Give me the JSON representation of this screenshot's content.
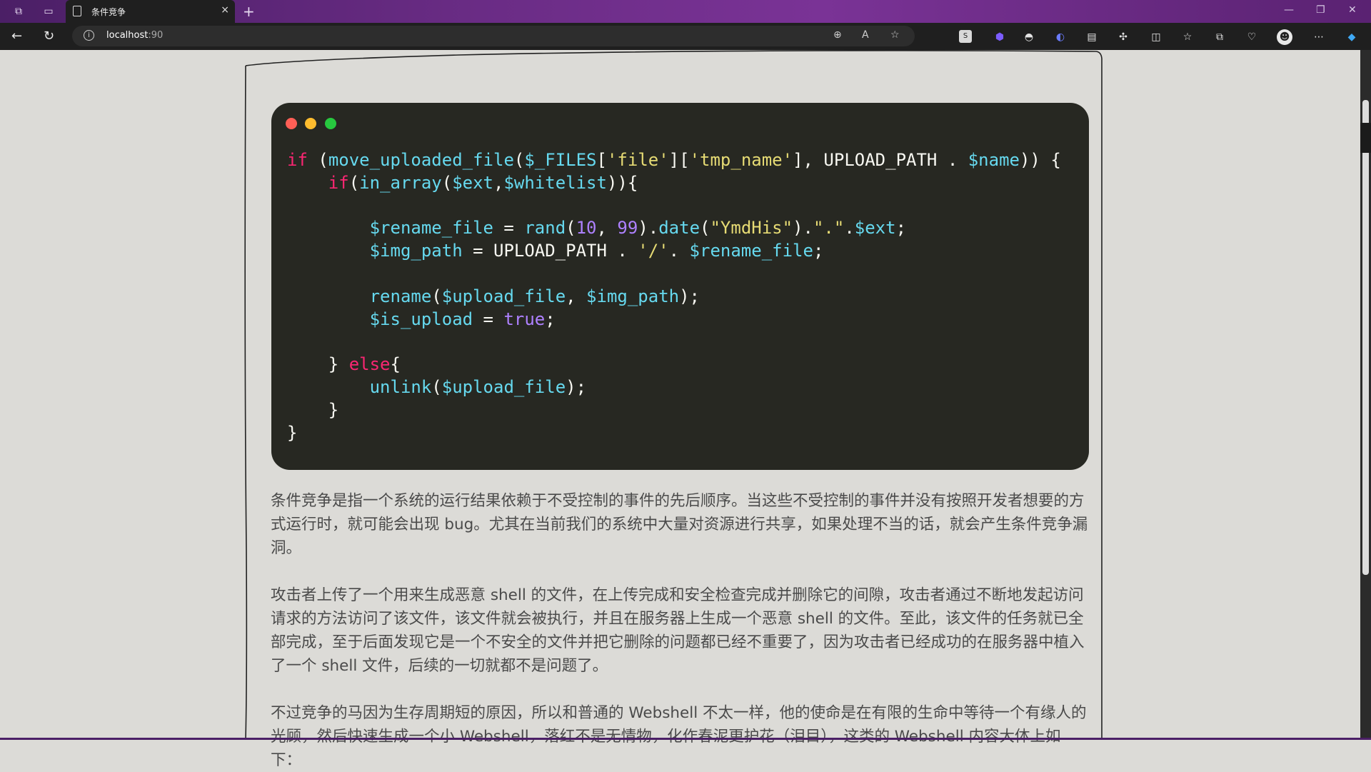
{
  "browser": {
    "tab_title": "条件竞争",
    "new_tab_glyph": "+",
    "close_glyph": "×",
    "url_host": "localhost",
    "url_port": ":90"
  },
  "code_lines": [
    [
      [
        "kw",
        "if"
      ],
      [
        "pl",
        " ("
      ],
      [
        "fn",
        "move_uploaded_file"
      ],
      [
        "pl",
        "("
      ],
      [
        "var",
        "$_FILES"
      ],
      [
        "pl",
        "["
      ],
      [
        "str",
        "'file'"
      ],
      [
        "pl",
        "]["
      ],
      [
        "str",
        "'tmp_name'"
      ],
      [
        "pl",
        "], UPLOAD_PATH . "
      ],
      [
        "var",
        "$name"
      ],
      [
        "pl",
        ")) {"
      ]
    ],
    [
      [
        "pl",
        "    "
      ],
      [
        "kw",
        "if"
      ],
      [
        "pl",
        "("
      ],
      [
        "fn",
        "in_array"
      ],
      [
        "pl",
        "("
      ],
      [
        "var",
        "$ext"
      ],
      [
        "pl",
        ","
      ],
      [
        "var",
        "$whitelist"
      ],
      [
        "pl",
        ")){"
      ]
    ],
    [
      [
        "pl",
        ""
      ]
    ],
    [
      [
        "pl",
        "        "
      ],
      [
        "var",
        "$rename_file"
      ],
      [
        "pl",
        " = "
      ],
      [
        "fn",
        "rand"
      ],
      [
        "pl",
        "("
      ],
      [
        "num",
        "10"
      ],
      [
        "pl",
        ", "
      ],
      [
        "num",
        "99"
      ],
      [
        "pl",
        ")."
      ],
      [
        "fn",
        "date"
      ],
      [
        "pl",
        "("
      ],
      [
        "str",
        "\"YmdHis\""
      ],
      [
        "pl",
        ")."
      ],
      [
        "str",
        "\".\""
      ],
      [
        "pl",
        "."
      ],
      [
        "var",
        "$ext"
      ],
      [
        "pl",
        ";"
      ]
    ],
    [
      [
        "pl",
        "        "
      ],
      [
        "var",
        "$img_path"
      ],
      [
        "pl",
        " = UPLOAD_PATH . "
      ],
      [
        "str",
        "'/'"
      ],
      [
        "pl",
        ". "
      ],
      [
        "var",
        "$rename_file"
      ],
      [
        "pl",
        ";"
      ]
    ],
    [
      [
        "pl",
        ""
      ]
    ],
    [
      [
        "pl",
        "        "
      ],
      [
        "fn",
        "rename"
      ],
      [
        "pl",
        "("
      ],
      [
        "var",
        "$upload_file"
      ],
      [
        "pl",
        ", "
      ],
      [
        "var",
        "$img_path"
      ],
      [
        "pl",
        ");"
      ]
    ],
    [
      [
        "pl",
        "        "
      ],
      [
        "var",
        "$is_upload"
      ],
      [
        "pl",
        " = "
      ],
      [
        "num",
        "true"
      ],
      [
        "pl",
        ";"
      ]
    ],
    [
      [
        "pl",
        ""
      ]
    ],
    [
      [
        "pl",
        "    } "
      ],
      [
        "kw",
        "else"
      ],
      [
        "pl",
        "{"
      ]
    ],
    [
      [
        "pl",
        "        "
      ],
      [
        "fn",
        "unlink"
      ],
      [
        "pl",
        "("
      ],
      [
        "var",
        "$upload_file"
      ],
      [
        "pl",
        ");"
      ]
    ],
    [
      [
        "pl",
        "    }"
      ]
    ],
    [
      [
        "pl",
        "}"
      ]
    ]
  ],
  "paragraphs": {
    "p1": "条件竞争是指一个系统的运行结果依赖于不受控制的事件的先后顺序。当这些不受控制的事件并没有按照开发者想要的方式运行时，就可能会出现 bug。尤其在当前我们的系统中大量对资源进行共享，如果处理不当的话，就会产生条件竞争漏洞。",
    "p2": "攻击者上传了一个用来生成恶意 shell 的文件，在上传完成和安全检查完成并删除它的间隙，攻击者通过不断地发起访问请求的方法访问了该文件，该文件就会被执行，并且在服务器上生成一个恶意 shell 的文件。至此，该文件的任务就已全部完成，至于后面发现它是一个不安全的文件并把它删除的问题都已经不重要了，因为攻击者已经成功的在服务器中植入了一个 shell 文件，后续的一切就都不是问题了。",
    "p3": "不过竞争的马因为生存周期短的原因，所以和普通的 Webshell 不太一样，他的使命是在有限的生命中等待一个有缘人的光顾，然后快速生成一个小 Webshell，落红不是无情物，化作春泥更护花（泪目），这类的 Webshell 内容大体上如下："
  },
  "colors": {
    "code_bg": "#272822",
    "dot_red": "#ff5f56",
    "dot_yellow": "#ffbd2e",
    "dot_green": "#27c93f",
    "page_bg": "#dcdbd7"
  }
}
